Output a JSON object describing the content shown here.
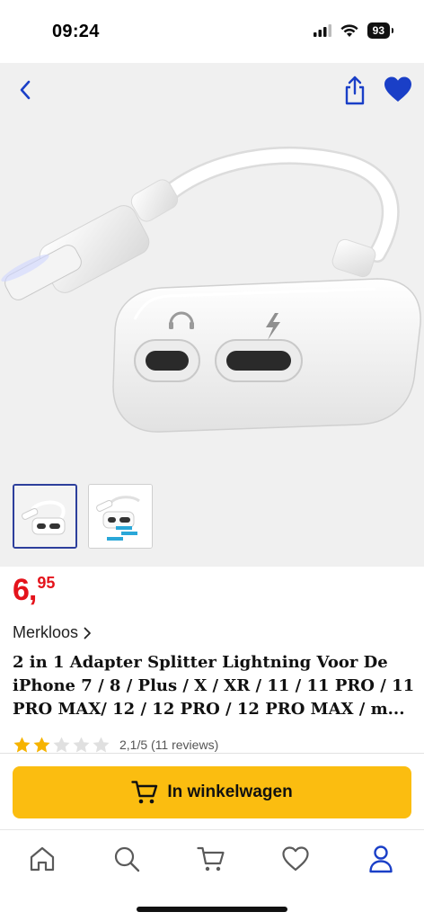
{
  "status_bar": {
    "time": "09:24",
    "battery": "93",
    "icons": [
      "signal-icon",
      "wifi-icon",
      "battery-icon"
    ]
  },
  "nav": {
    "icons": [
      "back-arrow-icon",
      "share-icon",
      "heart-filled-icon"
    ],
    "accent_color": "#1a3fc7"
  },
  "gallery": {
    "thumbnail_count": 2,
    "selected_index": 0
  },
  "product": {
    "price_main": "6,",
    "price_cents": "95",
    "price_color": "#e4131b",
    "brand": "Merkloos",
    "title_lines": [
      "2 in 1 Adapter Splitter Lightning Voor De",
      "iPhone 7 / 8 / Plus / X / XR / 11 / 11 PRO / 11",
      "PRO MAX/ 12 / 12 PRO / 12 PRO MAX / m..."
    ],
    "rating_value": 2.1,
    "rating_max": 5,
    "rating_text": "2,1/5 (11 reviews)",
    "star_color": "#f6b300"
  },
  "cart": {
    "label": "In winkelwagen",
    "button_color": "#fbbd10"
  },
  "tab_bar": {
    "tabs": [
      "home-icon",
      "search-icon",
      "cart-icon",
      "heart-outline-icon",
      "account-icon"
    ],
    "active_index": 4
  }
}
